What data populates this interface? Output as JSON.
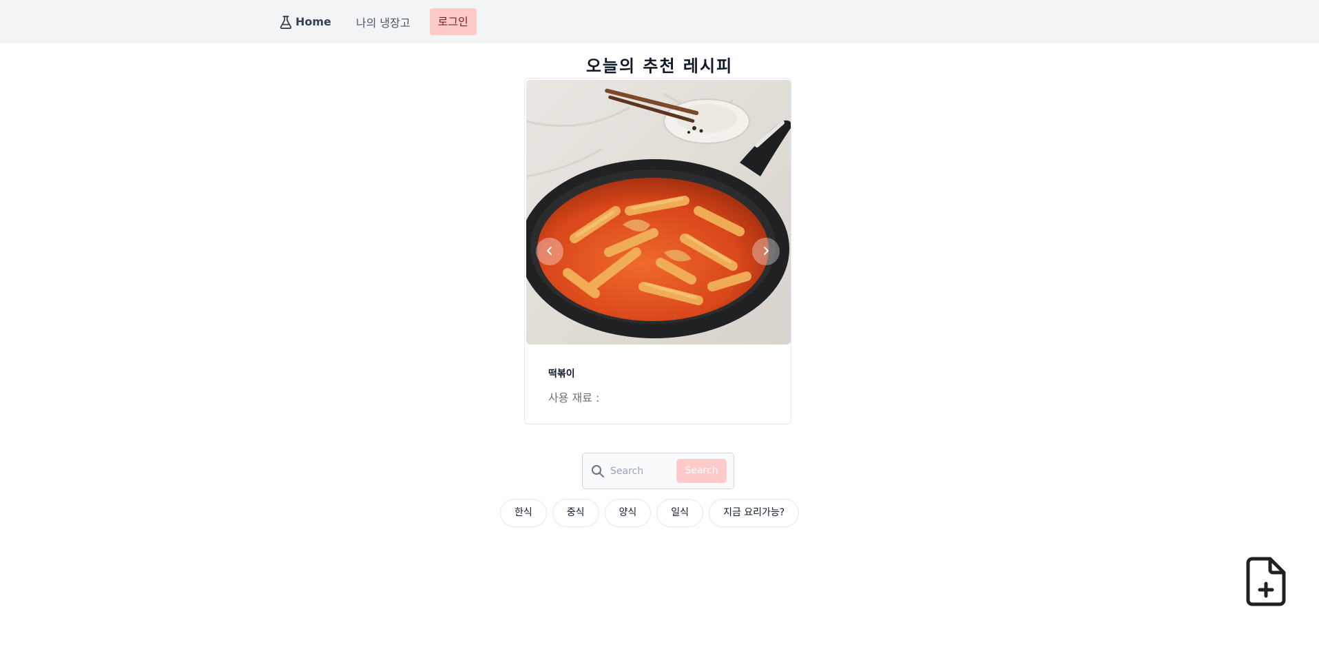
{
  "nav": {
    "home_label": "Home",
    "fridge_label": "나의 냉장고",
    "login_label": "로그인"
  },
  "page": {
    "title": "오늘의 추천 레시피"
  },
  "recipe": {
    "name": "떡볶이",
    "ingredients_label": "사용 재료 :",
    "image": "tteokbokki-in-pan-photo"
  },
  "search": {
    "placeholder": "Search",
    "button_label": "Search"
  },
  "categories": [
    "한식",
    "중식",
    "양식",
    "일식",
    "지금 요리가능?"
  ],
  "colors": {
    "navbar_bg": "#f3f4f6",
    "accent_pink": "#fecaca"
  },
  "icons": {
    "home": "flask-icon",
    "search": "search-icon",
    "carousel_prev": "chevron-left-icon",
    "carousel_next": "chevron-right-icon",
    "fab": "file-plus-icon"
  }
}
